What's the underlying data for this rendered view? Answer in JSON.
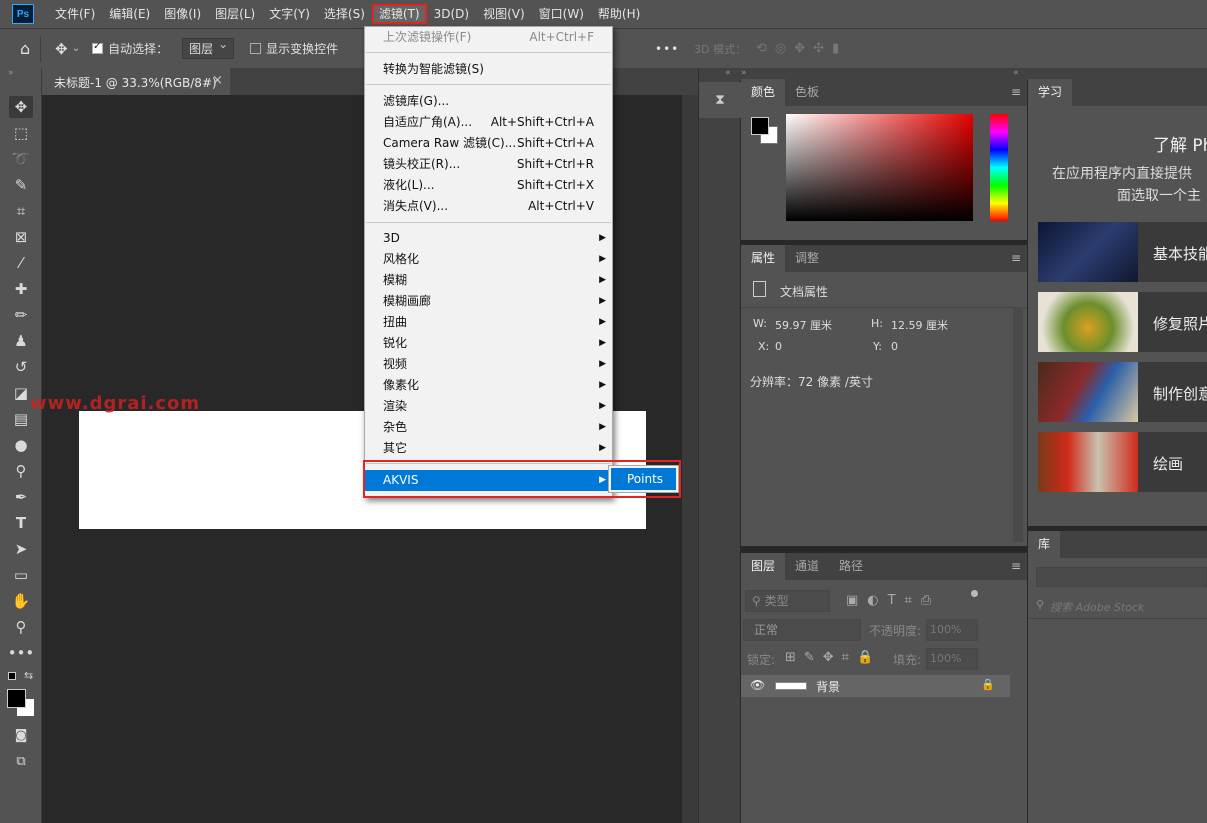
{
  "app": {
    "logo": "Ps"
  },
  "menubar": {
    "items": [
      "文件(F)",
      "编辑(E)",
      "图像(I)",
      "图层(L)",
      "文字(Y)",
      "选择(S)",
      "滤镜(T)",
      "3D(D)",
      "视图(V)",
      "窗口(W)",
      "帮助(H)"
    ],
    "active_index": 6
  },
  "options": {
    "auto_select_label": "自动选择：",
    "auto_select_value": "图层",
    "show_transform_label": "显示变换控件",
    "mode_3d_label": "3D 模式：",
    "more_label": "•••"
  },
  "document": {
    "tab_title": "未标题-1 @ 33.3%(RGB/8#)",
    "close_glyph": "×",
    "watermark": "www.dgrai.com"
  },
  "filter_menu": {
    "last_filter": {
      "label": "上次滤镜操作(F)",
      "shortcut": "Alt+Ctrl+F"
    },
    "convert_smart": "转换为智能滤镜(S)",
    "items": [
      {
        "label": "滤镜库(G)...",
        "shortcut": ""
      },
      {
        "label": "自适应广角(A)...",
        "shortcut": "Alt+Shift+Ctrl+A"
      },
      {
        "label": "Camera Raw 滤镜(C)...",
        "shortcut": "Shift+Ctrl+A"
      },
      {
        "label": "镜头校正(R)...",
        "shortcut": "Shift+Ctrl+R"
      },
      {
        "label": "液化(L)...",
        "shortcut": "Shift+Ctrl+X"
      },
      {
        "label": "消失点(V)...",
        "shortcut": "Alt+Ctrl+V"
      }
    ],
    "submenus": [
      "3D",
      "风格化",
      "模糊",
      "模糊画廊",
      "扭曲",
      "锐化",
      "视频",
      "像素化",
      "渲染",
      "杂色",
      "其它"
    ],
    "plugin": "AKVIS",
    "plugin_item": "Points"
  },
  "color_panel": {
    "tabs": [
      "颜色",
      "色板"
    ]
  },
  "properties_panel": {
    "tabs": [
      "属性",
      "调整"
    ],
    "doc_props": "文档属性",
    "w_label": "W:",
    "w_value": "59.97 厘米",
    "h_label": "H:",
    "h_value": "12.59 厘米",
    "x_label": "X:",
    "x_value": "0",
    "y_label": "Y:",
    "y_value": "0",
    "resolution": "分辨率：72 像素 /英寸"
  },
  "layers_panel": {
    "tabs": [
      "图层",
      "通道",
      "路径"
    ],
    "kind_filter": "类型",
    "blend_mode": "正常",
    "opacity_label": "不透明度:",
    "opacity_value": "100%",
    "lock_label": "锁定:",
    "fill_label": "填充:",
    "fill_value": "100%",
    "layer_name": "背景"
  },
  "learn_panel": {
    "tab": "学习",
    "heading": "了解 Ph",
    "sub1": "在应用程序内直接提供",
    "sub2": "面选取一个主",
    "cards": [
      "基本技能",
      "修复照片",
      "制作创意",
      "绘画"
    ]
  },
  "library_panel": {
    "tab": "库",
    "search_placeholder": "搜索 Adobe Stock"
  },
  "colors": {
    "menu_highlight": "#0078d7",
    "callout_red": "#e02525",
    "ui_bg": "#535353",
    "canvas_bg": "#282828"
  }
}
